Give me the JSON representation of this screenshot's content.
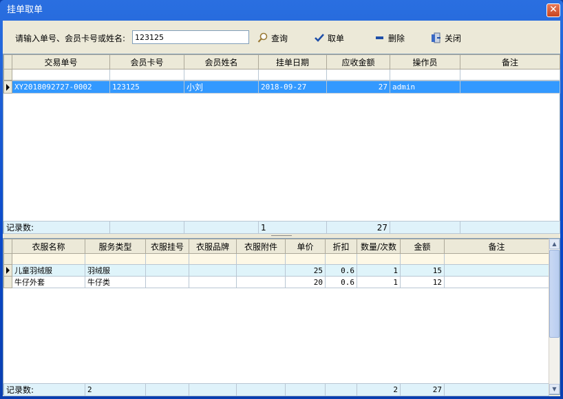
{
  "window": {
    "title": "挂单取单",
    "close_glyph": "✕"
  },
  "toolbar": {
    "search_label": "请输入单号、会员卡号或姓名:",
    "search_value": "123125",
    "query_label": "查询",
    "take_label": "取单",
    "delete_label": "删除",
    "close_label": "关闭"
  },
  "orders": {
    "columns": [
      "交易单号",
      "会员卡号",
      "会员姓名",
      "挂单日期",
      "应收金额",
      "操作员",
      "备注"
    ],
    "rows": [
      {
        "order_no": "XY2018092727-0002",
        "card": "123125",
        "name": "小刘",
        "date": "2018-09-27",
        "amount": "27",
        "operator": "admin",
        "note": ""
      }
    ],
    "footer": {
      "label": "记录数:",
      "count": "1",
      "amount_total": "27"
    }
  },
  "items": {
    "columns": [
      "衣服名称",
      "服务类型",
      "衣服挂号",
      "衣服品牌",
      "衣服附件",
      "单价",
      "折扣",
      "数量/次数",
      "金额",
      "备注"
    ],
    "rows": [
      {
        "name": "儿童羽绒服",
        "service": "羽绒服",
        "tag": "",
        "brand": "",
        "attach": "",
        "price": "25",
        "discount": "0.6",
        "qty": "1",
        "amount": "15",
        "note": ""
      },
      {
        "name": "牛仔外套",
        "service": "牛仔类",
        "tag": "",
        "brand": "",
        "attach": "",
        "price": "20",
        "discount": "0.6",
        "qty": "1",
        "amount": "12",
        "note": ""
      }
    ],
    "footer": {
      "label": "记录数:",
      "count": "2",
      "qty_total": "2",
      "amount_total": "27"
    }
  },
  "colors": {
    "selection": "#3399ff",
    "titlebar": "#0a49c9",
    "client_bg": "#ece9d8"
  }
}
